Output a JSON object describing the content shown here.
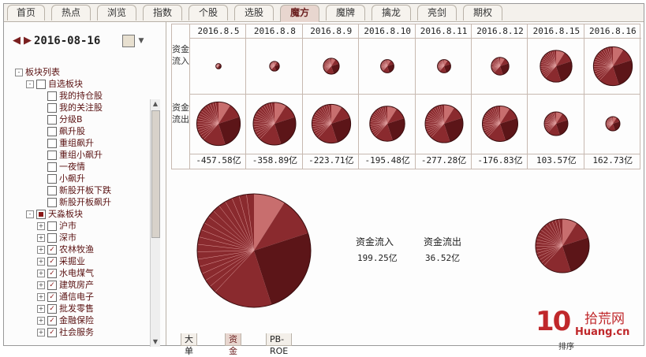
{
  "tabs": [
    {
      "label": "首页"
    },
    {
      "label": "热点"
    },
    {
      "label": "浏览"
    },
    {
      "label": "指数"
    },
    {
      "label": "个股"
    },
    {
      "label": "选股"
    },
    {
      "label": "魔方",
      "active": true
    },
    {
      "label": "魔牌"
    },
    {
      "label": "擒龙"
    },
    {
      "label": "亮剑"
    },
    {
      "label": "期权"
    }
  ],
  "left": {
    "date": "2016-08-16",
    "tree": [
      {
        "label": "板块列表",
        "level": 0,
        "expander": "-",
        "checkbox": null
      },
      {
        "label": "自选板块",
        "level": 1,
        "expander": "-",
        "checkbox": "empty"
      },
      {
        "label": "我的持仓股",
        "level": 2,
        "expander": null,
        "checkbox": "empty"
      },
      {
        "label": "我的关注股",
        "level": 2,
        "expander": null,
        "checkbox": "empty"
      },
      {
        "label": "分级B",
        "level": 2,
        "expander": null,
        "checkbox": "empty"
      },
      {
        "label": "飙升股",
        "level": 2,
        "expander": null,
        "checkbox": "empty"
      },
      {
        "label": "重组飙升",
        "level": 2,
        "expander": null,
        "checkbox": "empty"
      },
      {
        "label": "重组小飙升",
        "level": 2,
        "expander": null,
        "checkbox": "empty"
      },
      {
        "label": "一夜情",
        "level": 2,
        "expander": null,
        "checkbox": "empty"
      },
      {
        "label": "小飙升",
        "level": 2,
        "expander": null,
        "checkbox": "empty"
      },
      {
        "label": "新股开板下跌",
        "level": 2,
        "expander": null,
        "checkbox": "empty"
      },
      {
        "label": "新股开板飙升",
        "level": 2,
        "expander": null,
        "checkbox": "empty"
      },
      {
        "label": "天淼板块",
        "level": 1,
        "expander": "-",
        "checkbox": "part"
      },
      {
        "label": "沪市",
        "level": 2,
        "expander": "+",
        "checkbox": "empty"
      },
      {
        "label": "深市",
        "level": 2,
        "expander": "+",
        "checkbox": "empty"
      },
      {
        "label": "农林牧渔",
        "level": 2,
        "expander": "+",
        "checkbox": "checked"
      },
      {
        "label": "采掘业",
        "level": 2,
        "expander": "+",
        "checkbox": "checked"
      },
      {
        "label": "水电煤气",
        "level": 2,
        "expander": "+",
        "checkbox": "checked"
      },
      {
        "label": "建筑房产",
        "level": 2,
        "expander": "+",
        "checkbox": "checked"
      },
      {
        "label": "通信电子",
        "level": 2,
        "expander": "+",
        "checkbox": "checked"
      },
      {
        "label": "批发零售",
        "level": 2,
        "expander": "+",
        "checkbox": "checked"
      },
      {
        "label": "金融保险",
        "level": 2,
        "expander": "+",
        "checkbox": "checked"
      },
      {
        "label": "社会服务",
        "level": 2,
        "expander": "+",
        "checkbox": "checked"
      }
    ]
  },
  "grid": {
    "row_label_in": "资金流入",
    "row_label_out": "资金流出",
    "columns": [
      {
        "date": "2016.8.5",
        "net": "-457.58亿",
        "in_frac": 0.12,
        "out_frac": 0.92
      },
      {
        "date": "2016.8.8",
        "net": "-358.89亿",
        "in_frac": 0.22,
        "out_frac": 0.9
      },
      {
        "date": "2016.8.9",
        "net": "-223.71亿",
        "in_frac": 0.36,
        "out_frac": 0.82
      },
      {
        "date": "2016.8.10",
        "net": "-195.48亿",
        "in_frac": 0.3,
        "out_frac": 0.74
      },
      {
        "date": "2016.8.11",
        "net": "-277.28亿",
        "in_frac": 0.3,
        "out_frac": 0.8
      },
      {
        "date": "2016.8.12",
        "net": "-176.83亿",
        "in_frac": 0.4,
        "out_frac": 0.75
      },
      {
        "date": "2016.8.15",
        "net": "103.57亿",
        "in_frac": 0.72,
        "out_frac": 0.5
      },
      {
        "date": "2016.8.16",
        "net": "162.73亿",
        "in_frac": 0.88,
        "out_frac": 0.3
      }
    ]
  },
  "summary": {
    "in_label": "资金流入",
    "in_value": "199.25亿",
    "out_label": "资金流出",
    "out_value": "36.52亿"
  },
  "bottom_tabs": [
    {
      "label": "大单"
    },
    {
      "label": "资金",
      "active": true
    },
    {
      "label": "PB-ROE"
    }
  ],
  "sort_label": "排序",
  "watermark": {
    "num": "10",
    "title": "拾荒网",
    "url": "Huang.cn"
  },
  "colors": {
    "pie_dark": "#5c1518",
    "pie_mid": "#8a2a2e",
    "pie_light": "#c86e6e",
    "accent": "#7a1f1f"
  }
}
